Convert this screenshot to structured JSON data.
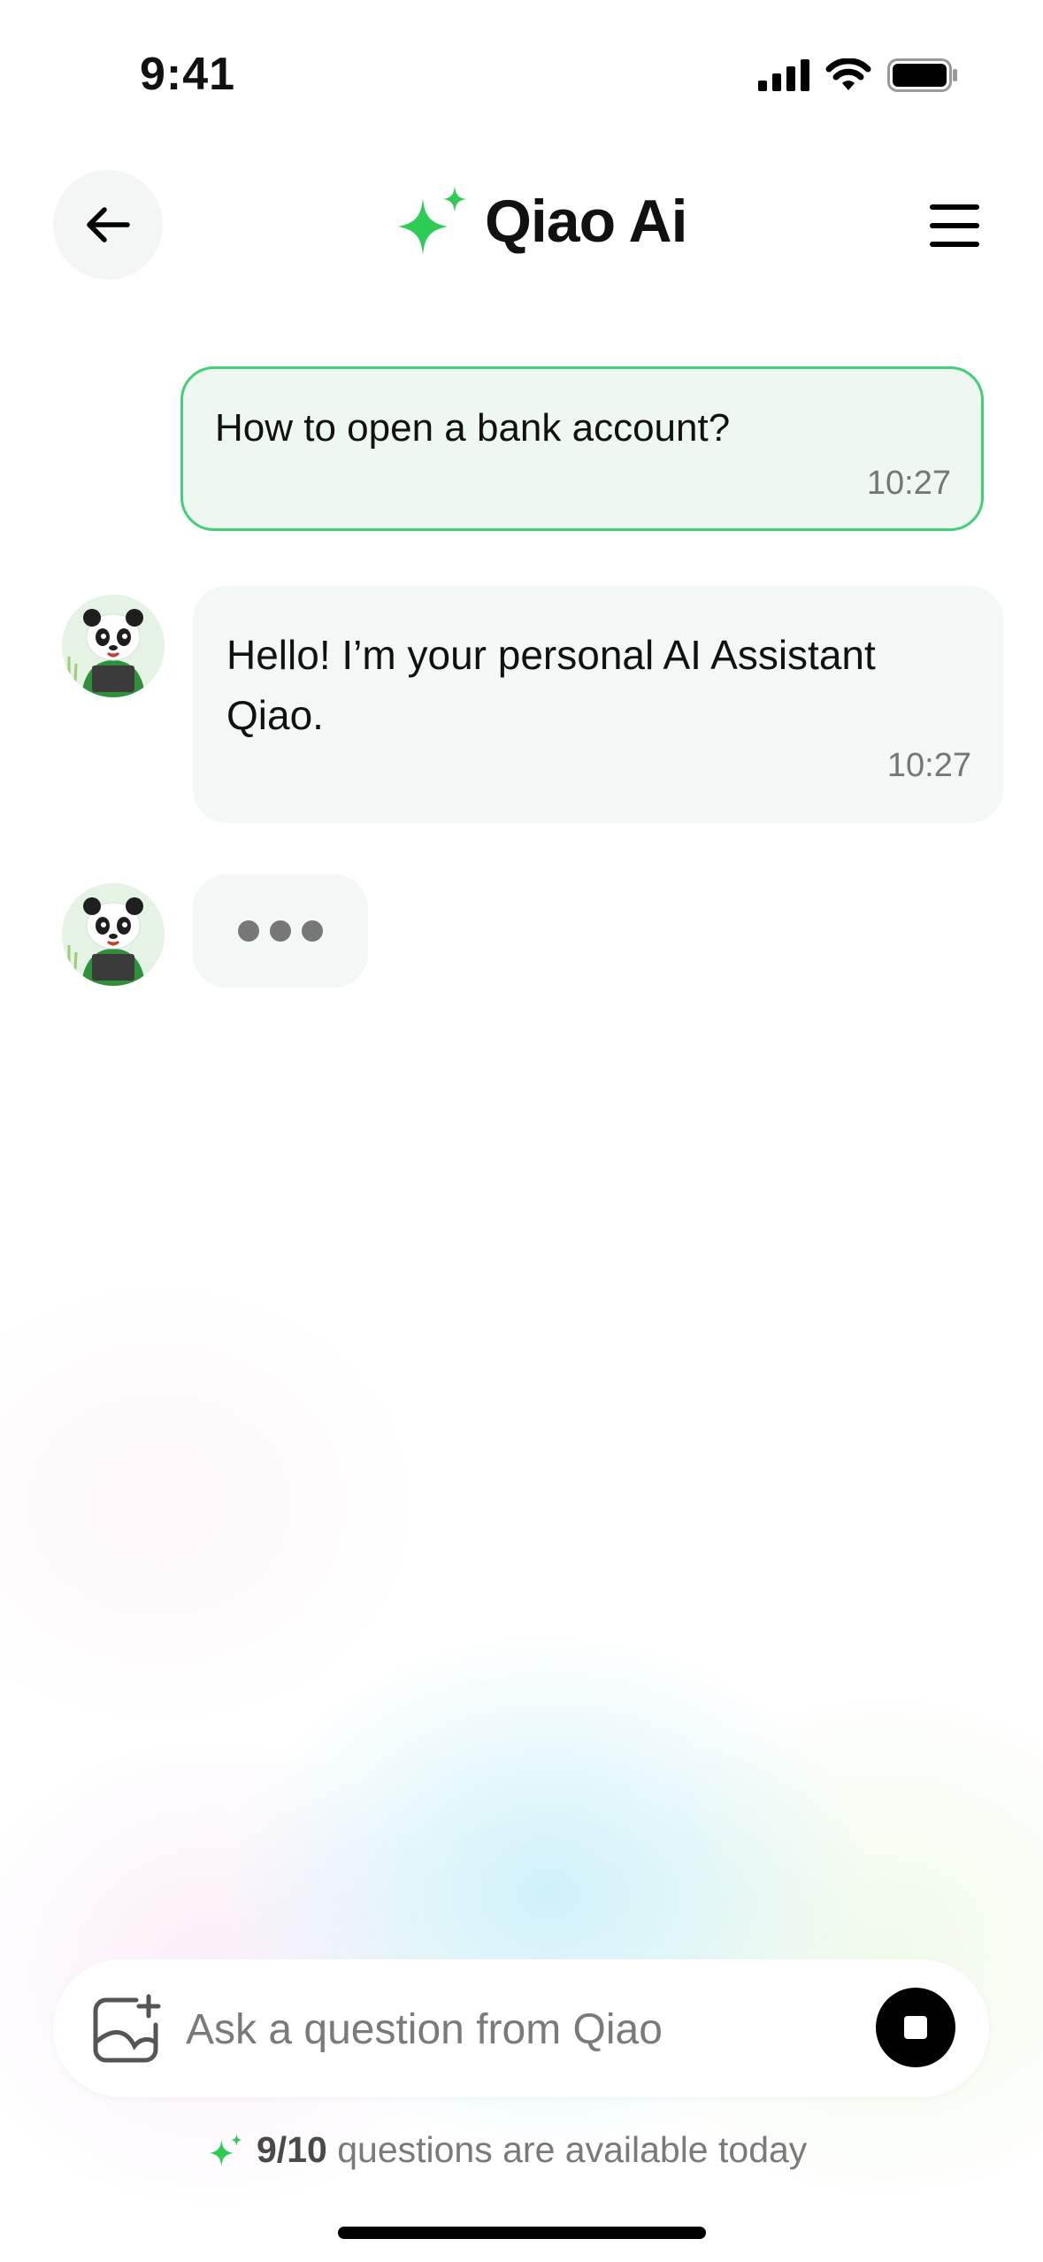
{
  "status": {
    "time": "9:41"
  },
  "header": {
    "title": "Qiao Ai",
    "back_icon": "arrow-left-icon",
    "menu_icon": "menu-icon",
    "logo_icon": "sparkle-icon"
  },
  "colors": {
    "accent": "#2ecc55",
    "user_bubble_border": "#3fd079",
    "user_bubble_bg": "#eef8f1",
    "ai_bubble_bg": "#f3f7f5"
  },
  "messages": [
    {
      "sender": "user",
      "text": "How to open a bank account?",
      "time": "10:27"
    },
    {
      "sender": "assistant",
      "text": "Hello! I’m your personal AI Assistant Qiao.",
      "time": "10:27"
    }
  ],
  "typing_indicator": {
    "visible": true
  },
  "composer": {
    "placeholder": "Ask a question from Qiao",
    "value": "",
    "attach_icon": "image-add-icon",
    "stop_icon": "stop-icon"
  },
  "quota": {
    "count": "9/10",
    "text": "questions are available today"
  }
}
